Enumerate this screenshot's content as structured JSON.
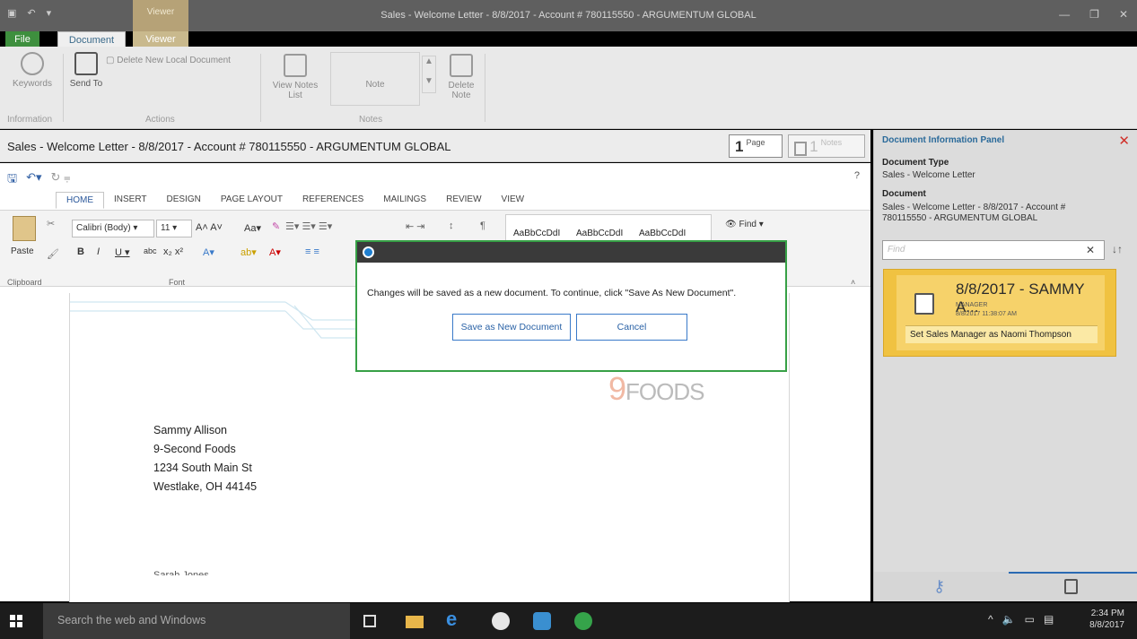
{
  "window": {
    "title": "Sales - Welcome Letter - 8/8/2017 - Account # 780115550 - ARGUMENTUM GLOBAL",
    "viewer_tab_top": "Viewer"
  },
  "main_tabs": {
    "file": "File",
    "document": "Document",
    "viewer": "Viewer"
  },
  "ribbon": {
    "keywords": "Keywords",
    "send_to": "Send To",
    "delete_new_local": "Delete New Local Document",
    "view_notes_list": "View Notes List",
    "note": "Note",
    "delete_note": "Delete Note",
    "group_information": "Information",
    "group_actions": "Actions",
    "group_notes": "Notes"
  },
  "doc_header": {
    "title": "Sales - Welcome Letter - 8/8/2017 - Account # 780115550 - ARGUMENTUM GLOBAL",
    "page_count": "1",
    "page_label": "Page",
    "notes_count": "1",
    "notes_label": "Notes"
  },
  "word": {
    "help": "?",
    "tabs": [
      "HOME",
      "INSERT",
      "DESIGN",
      "PAGE LAYOUT",
      "REFERENCES",
      "MAILINGS",
      "REVIEW",
      "VIEW"
    ],
    "font_name": "Calibri (Body)",
    "font_size": "11",
    "paste": "Paste",
    "styles": [
      "AaBbCcDdI",
      "AaBbCcDdI",
      "AaBbCcDdI"
    ],
    "find": "Find",
    "group_clipboard": "Clipboard",
    "group_font": "Font"
  },
  "letter": {
    "lines": [
      "Sammy Allison",
      "9-Second Foods",
      "1234 South Main St",
      "Westlake, OH 44145"
    ],
    "signature_partial": "Sarah Jones",
    "logo_word": "FOODS",
    "logo_nine": "9"
  },
  "info_panel": {
    "title": "Document Information Panel",
    "doc_type_label": "Document Type",
    "doc_type_value": "Sales - Welcome Letter",
    "document_label": "Document",
    "document_value_1": "Sales - Welcome Letter - 8/8/2017 - Account #",
    "document_value_2": "780115550 - ARGUMENTUM GLOBAL",
    "find_placeholder": "Find",
    "note": {
      "date_user": "8/8/2017 - SAMMY A...",
      "role": "MANAGER",
      "timestamp": "8/8/2017 11:38:07 AM",
      "text": "Set Sales Manager as Naomi Thompson"
    }
  },
  "modal": {
    "message": "Changes will be saved as a new document. To continue, click \"Save As New Document\".",
    "save_button": "Save as New Document",
    "cancel_button": "Cancel"
  },
  "taskbar": {
    "search_placeholder": "Search the web and Windows",
    "time": "2:34 PM",
    "date": "8/8/2017"
  },
  "colors": {
    "accent_green": "#37a046",
    "file_tab": "#3e8f3e",
    "note_yellow": "#f0c241",
    "close_red": "#d0302a"
  }
}
